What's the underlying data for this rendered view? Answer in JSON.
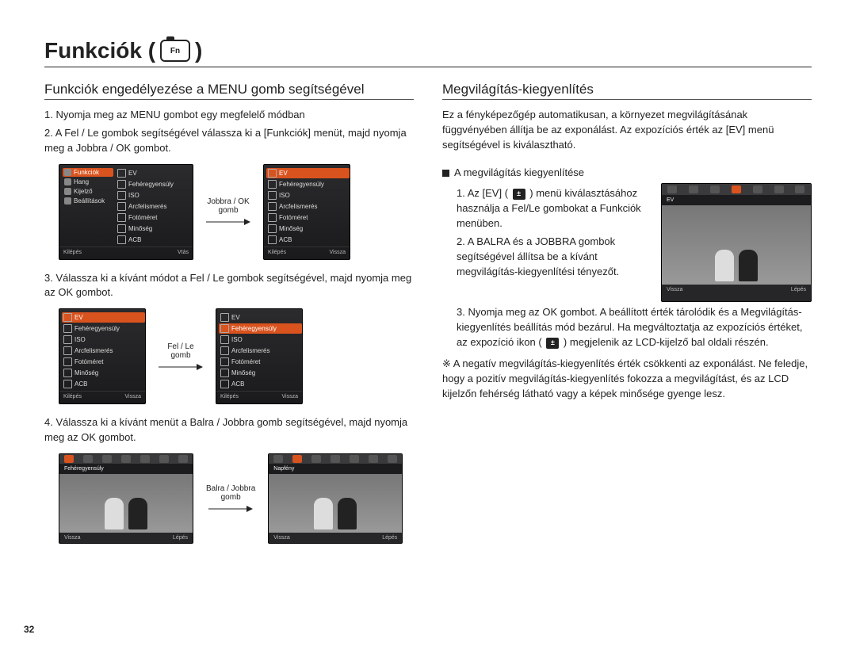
{
  "page_number": "32",
  "title": "Funkciók (",
  "title_close": ")",
  "camera_fn": "Fn",
  "left": {
    "heading": "Funkciók engedélyezése a MENU gomb segítségével",
    "s1": "1. Nyomja meg az MENU gombot egy megfelelő módban",
    "s2": "2. A Fel / Le gombok segítségével válassza ki a [Funkciók] menüt, majd nyomja meg a Jobbra / OK gombot.",
    "arrow1a": "Jobbra / OK",
    "arrow1b": "gomb",
    "s3": "3. Válassza ki a kívánt módot a Fel / Le gombok segítségével, majd nyomja meg az OK gombot.",
    "arrow2a": "Fel / Le",
    "arrow2b": "gomb",
    "s4": "4. Válassza ki a kívánt menüt a Balra / Jobbra gomb segítségével, majd nyomja meg az OK gombot.",
    "arrow3a": "Balra / Jobbra",
    "arrow3b": "gomb",
    "menu_side": {
      "funkciok": "Funkciók",
      "hang": "Hang",
      "kijelzo": "Kijelző",
      "beallitasok": "Beállítások"
    },
    "menu_panel": {
      "ev": "EV",
      "feher": "Fehéregyensúly",
      "iso": "ISO",
      "arc": "Arcfelismerés",
      "fotomeret": "Fotóméret",
      "minoseg": "Minőség",
      "acb": "ACB",
      "vtas": "Vtás"
    },
    "foot_kilepes": "Kilépés",
    "foot_vissza": "Vissza",
    "ev_label_feher": "Fehéregyensúly",
    "ev_label_napfeny": "Napfény",
    "ev_foot_vissza": "Vissza",
    "ev_foot_lepes": "Lépés"
  },
  "right": {
    "heading": "Megvilágítás-kiegyenlítés",
    "intro": "Ez a fényképezőgép automatikusan, a környezet megvilágításának függvényében állítja be az exponálást. Az expozíciós érték az [EV] menü segítségével is kiválasztható.",
    "bullet": "A megvilágítás kiegyenlítése",
    "s1a": "1. Az [EV] (",
    "s1b": ") menü kiválasztásához használja a Fel/Le gombokat a Funkciók menüben.",
    "s2": "2. A BALRA és a JOBBRA gombok segítségével állítsa be a kívánt megvilágítás-kiegyenlítési tényezőt.",
    "s3a": "3. Nyomja meg az OK gombot. A beállított érték tárolódik és a Megvilágítás-kiegyenlítés beállítás mód bezárul. Ha megváltoztatja az expozíciós értéket, az expozíció ikon (",
    "s3b": ") megjelenik az LCD-kijelző bal oldali részén.",
    "note": "※ A negatív megvilágítás-kiegyenlítés érték csökkenti az exponálást. Ne feledje, hogy a pozitív megvilágítás-kiegyenlítés fokozza a megvilágítást, és az LCD kijelzőn fehérség látható vagy a képek minősége gyenge lesz.",
    "ev_label": "EV",
    "ev_foot_vissza": "Vissza",
    "ev_foot_lepes": "Lépés",
    "z_glyph": "±"
  }
}
